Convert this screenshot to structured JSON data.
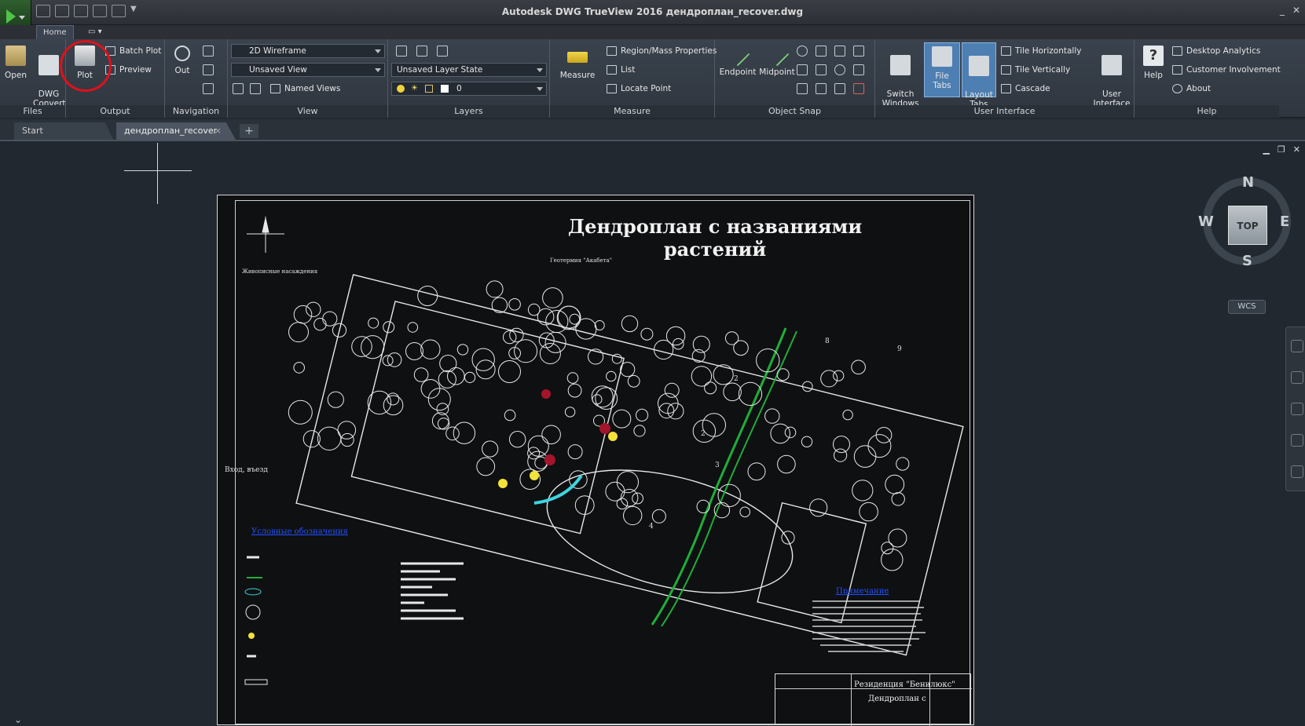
{
  "titlebar": {
    "title": "Autodesk DWG TrueView 2016   дендроплан_recover.dwg",
    "minimize_icon": "minimize-icon",
    "close_icon": "close-icon"
  },
  "ribbon_tabs": [
    {
      "label": "Home"
    },
    {
      "label": ""
    }
  ],
  "ribbon": {
    "files": {
      "label": "Files",
      "open": "Open",
      "dwg_convert": "DWG\nConvert"
    },
    "output": {
      "label": "Output",
      "plot": "Plot",
      "batch_plot": "Batch Plot",
      "preview": "Preview"
    },
    "navigation": {
      "label": "Navigation",
      "out": "Out"
    },
    "view": {
      "label": "View",
      "visual_style": "2D Wireframe",
      "named_view": "Unsaved View",
      "named_views": "Named Views"
    },
    "layers": {
      "label": "Layers",
      "layer_state": "Unsaved Layer State",
      "current_layer": "0"
    },
    "measure": {
      "label": "Measure",
      "measure": "Measure",
      "region_mass": "Region/Mass Properties",
      "list": "List",
      "locate_point": "Locate Point"
    },
    "object_snap": {
      "label": "Object Snap",
      "endpoint": "Endpoint",
      "midpoint": "Midpoint"
    },
    "user_interface": {
      "label": "User Interface",
      "switch_windows": "Switch\nWindows",
      "file_tabs": "File Tabs",
      "layout_tabs": "Layout\nTabs",
      "tile_horizontally": "Tile Horizontally",
      "tile_vertically": "Tile Vertically",
      "cascade": "Cascade",
      "user_interface": "User\nInterface"
    },
    "help": {
      "label": "Help",
      "help": "Help",
      "desktop_analytics": "Desktop Analytics",
      "customer_involvement": "Customer Involvement",
      "about": "About"
    }
  },
  "doc_tabs": [
    {
      "label": "Start"
    },
    {
      "label": "дендроплан_recover"
    }
  ],
  "add_tab": "+",
  "viewcube": {
    "top": "TOP",
    "north": "N",
    "south": "S",
    "east": "E",
    "west": "W",
    "wcs": "WCS"
  },
  "drawing": {
    "title": "Дендроплан с названиями растений",
    "entrance": "Вход, въезд",
    "legend_title": "Условные обозначения",
    "notes_title": "Примечание",
    "stamp_company": "Резиденция \"Бенилюкс\"",
    "stamp_sheet": "Дендроплан с",
    "site_labels": [
      "Геотермия \"Акабета\"",
      "Живописные насаждения"
    ],
    "area_numbers": [
      "8",
      "9",
      "2",
      "2",
      "3",
      "4"
    ]
  },
  "colors": {
    "titlebar": "#2c3036",
    "ribbon": "#3a424d",
    "canvas": "#212830",
    "annotation_circle": "#e0111a",
    "stream_line": "#1fae3a",
    "notes_blue": "#2350ff"
  }
}
